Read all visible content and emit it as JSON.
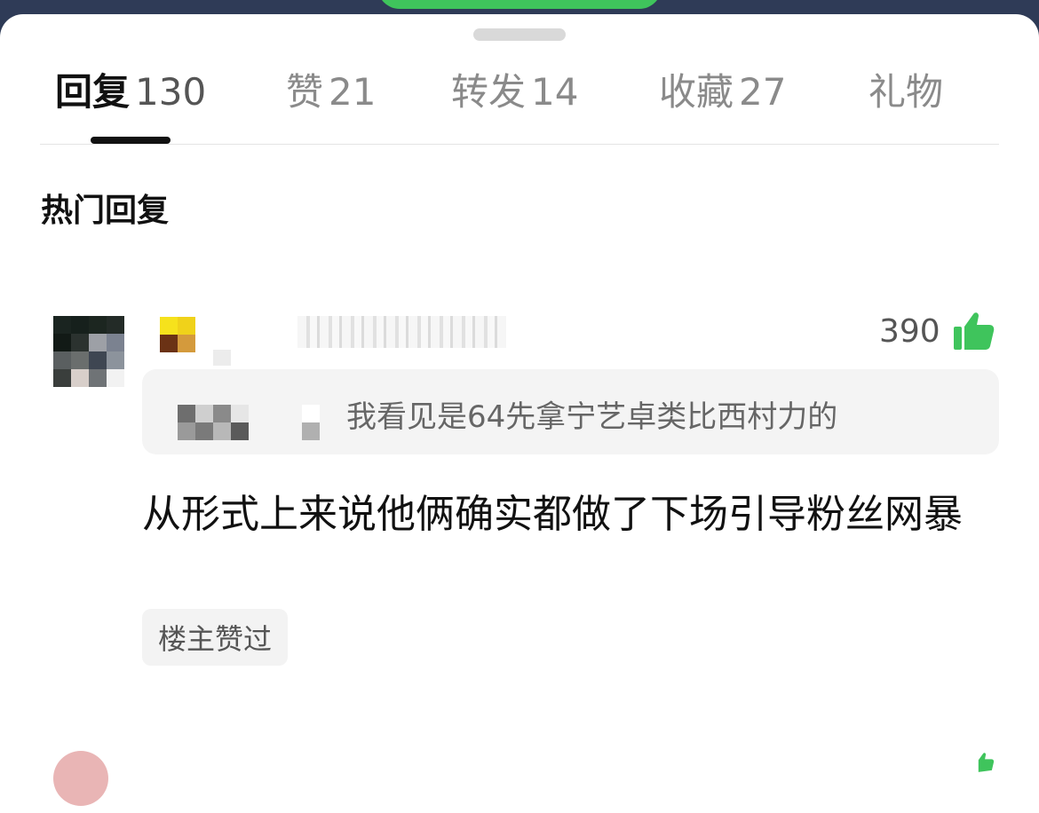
{
  "tabs": [
    {
      "label": "回复",
      "count": "130",
      "active": true
    },
    {
      "label": "赞",
      "count": "21",
      "active": false
    },
    {
      "label": "转发",
      "count": "14",
      "active": false
    },
    {
      "label": "收藏",
      "count": "27",
      "active": false
    },
    {
      "label": "礼物",
      "count": "",
      "active": false
    }
  ],
  "section": {
    "title": "热门回复"
  },
  "comment": {
    "likes": "390",
    "quote_text": "我看见是64先拿宁艺卓类比西村力的",
    "body": "从形式上来说他俩确实都做了下场引导粉丝网暴",
    "tag": "楼主赞过"
  },
  "colors": {
    "accent_green": "#3fc45c",
    "active_tab": "#111111",
    "inactive_tab": "#8a8a8a",
    "quote_bg": "#f4f4f4"
  },
  "icons": {
    "like": "thumbs-up-icon"
  }
}
